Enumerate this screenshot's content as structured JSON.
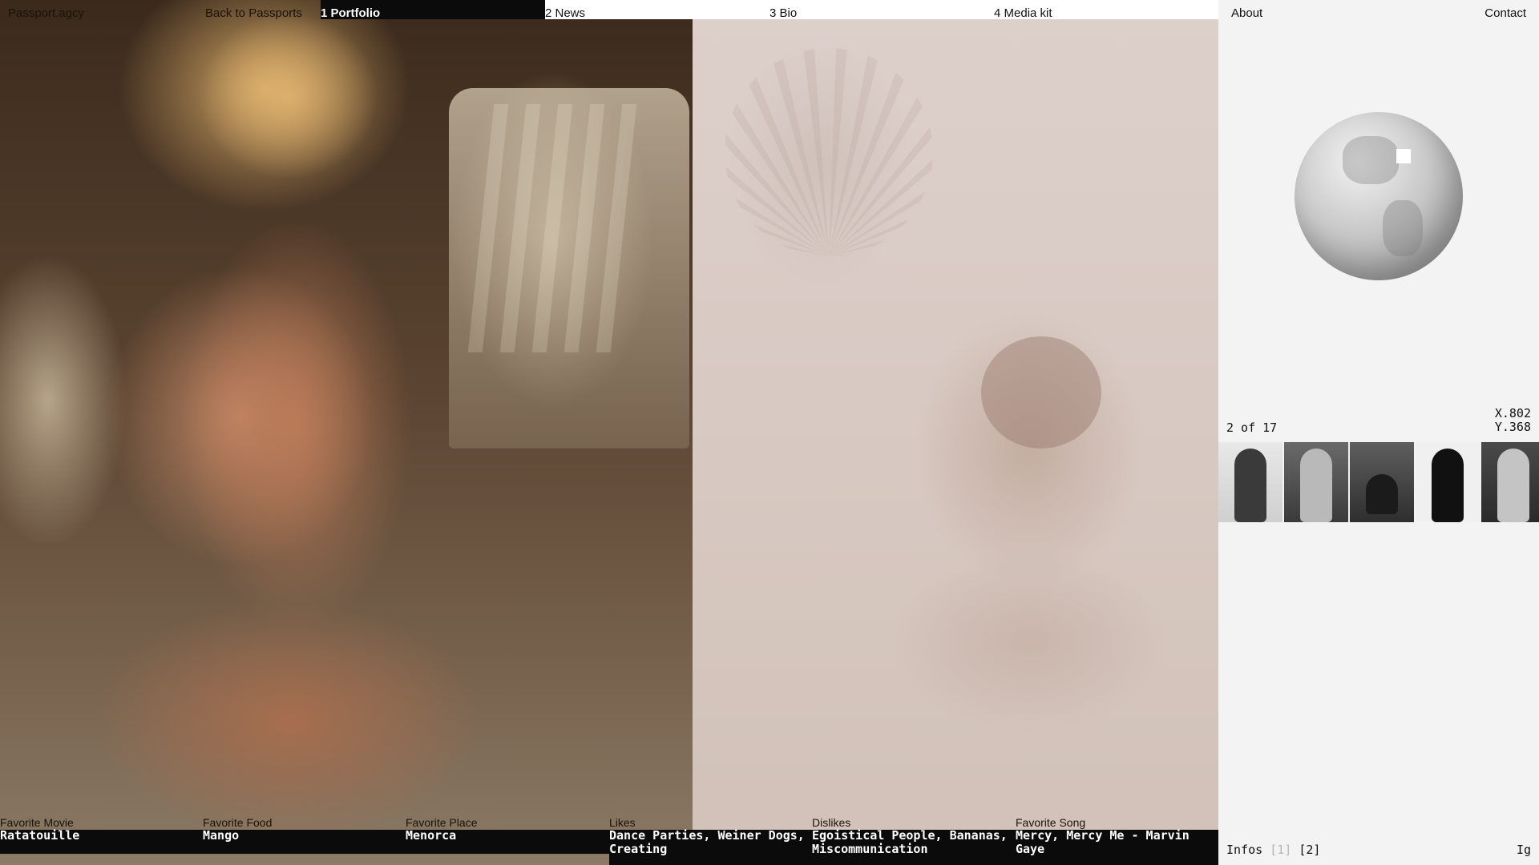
{
  "brand": "Passport.agcy",
  "nav": {
    "back": "Back to Passports",
    "tabs": [
      {
        "label": "1 Portfolio",
        "active": true
      },
      {
        "label": "2 News"
      },
      {
        "label": "3 Bio"
      },
      {
        "label": "4 Media kit"
      }
    ]
  },
  "panel": {
    "about": "About",
    "contact": "Contact",
    "coords": {
      "x": "X.802",
      "y": "Y.368"
    },
    "counter": "2 of 17",
    "footer": {
      "infos": "Infos",
      "one": "[1]",
      "two": "[2]",
      "ig": "Ig"
    }
  },
  "info": [
    {
      "label": "Favorite Movie",
      "value": "Ratatouille"
    },
    {
      "label": "Favorite Food",
      "value": "Mango"
    },
    {
      "label": "Favorite Place",
      "value": "Menorca"
    },
    {
      "label": "Likes",
      "value": "Dance Parties, Weiner Dogs, Creating"
    },
    {
      "label": "Dislikes",
      "value": "Egoistical People, Bananas, Miscommunication"
    },
    {
      "label": "Favorite Song",
      "value": "Mercy, Mercy Me - Marvin Gaye"
    }
  ],
  "colors": {
    "dark": "#0b0b0b",
    "panel": "#f3f3f3",
    "accent": "#ffffff"
  },
  "icons": [
    "globe-icon",
    "location-marker-icon"
  ]
}
